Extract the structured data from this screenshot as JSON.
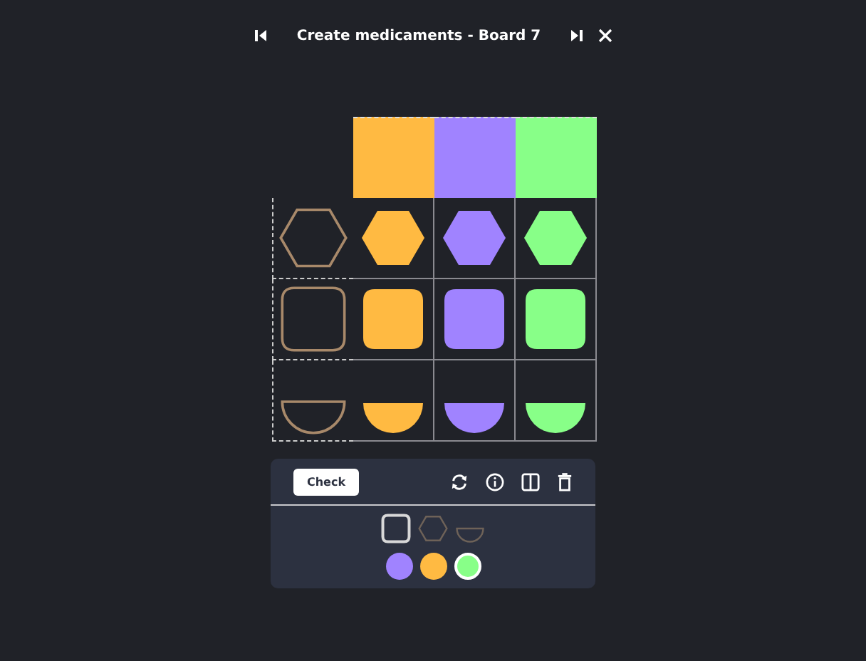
{
  "title": "Create medicaments - Board 7",
  "columns": [
    {
      "color": "#ffba42"
    },
    {
      "color": "#a083ff"
    },
    {
      "color": "#88ff88"
    }
  ],
  "rows": [
    {
      "kind": "hexagon",
      "cells": [
        {
          "color": "#ffba42"
        },
        {
          "color": "#a083ff"
        },
        {
          "color": "#88ff88"
        }
      ]
    },
    {
      "kind": "square",
      "cells": [
        {
          "color": "#ffba42"
        },
        {
          "color": "#a083ff"
        },
        {
          "color": "#88ff88"
        }
      ]
    },
    {
      "kind": "bowl",
      "cells": [
        {
          "color": "#ffba42"
        },
        {
          "color": "#a083ff"
        },
        {
          "color": "#88ff88"
        }
      ]
    }
  ],
  "check_button": "Check",
  "palette": {
    "shapes": [
      {
        "kind": "square",
        "selected": true
      },
      {
        "kind": "hexagon",
        "selected": false
      },
      {
        "kind": "bowl",
        "selected": false
      }
    ],
    "colors": [
      {
        "color": "#a083ff",
        "selected": false
      },
      {
        "color": "#ffba42",
        "selected": false
      },
      {
        "color": "#88ff88",
        "selected": true
      }
    ]
  }
}
